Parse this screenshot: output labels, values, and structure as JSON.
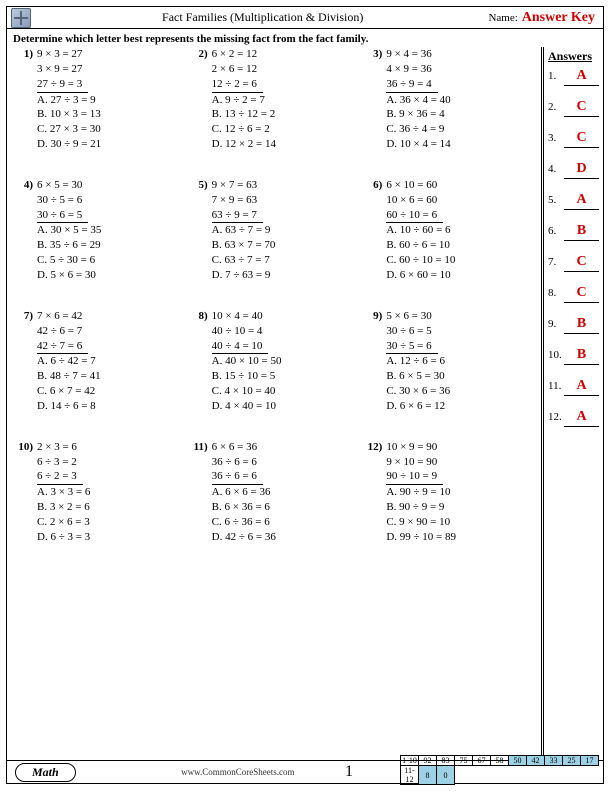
{
  "header": {
    "title": "Fact Families (Multiplication & Division)",
    "name_label": "Name:",
    "answer_key": "Answer Key"
  },
  "instructions": "Determine which letter best represents the missing fact from the fact family.",
  "answers_title": "Answers",
  "answers": [
    {
      "n": "1.",
      "v": "A"
    },
    {
      "n": "2.",
      "v": "C"
    },
    {
      "n": "3.",
      "v": "C"
    },
    {
      "n": "4.",
      "v": "D"
    },
    {
      "n": "5.",
      "v": "A"
    },
    {
      "n": "6.",
      "v": "B"
    },
    {
      "n": "7.",
      "v": "C"
    },
    {
      "n": "8.",
      "v": "C"
    },
    {
      "n": "9.",
      "v": "B"
    },
    {
      "n": "10.",
      "v": "B"
    },
    {
      "n": "11.",
      "v": "A"
    },
    {
      "n": "12.",
      "v": "A"
    }
  ],
  "problems": [
    {
      "n": "1)",
      "facts": [
        "9 × 3 = 27",
        "3 × 9 = 27",
        "27 ÷ 9 = 3"
      ],
      "choices": [
        "A. 27 ÷ 3 = 9",
        "B. 10 × 3 = 13",
        "C. 27 × 3 = 30",
        "D. 30 ÷ 9 = 21"
      ]
    },
    {
      "n": "2)",
      "facts": [
        "6 × 2 = 12",
        "2 × 6 = 12",
        "12 ÷ 2 = 6"
      ],
      "choices": [
        "A. 9 ÷ 2 = 7",
        "B. 13 ÷ 12 = 2",
        "C. 12 ÷ 6 = 2",
        "D. 12 × 2 = 14"
      ]
    },
    {
      "n": "3)",
      "facts": [
        "9 × 4 = 36",
        "4 × 9 = 36",
        "36 ÷ 9 = 4"
      ],
      "choices": [
        "A. 36 × 4 = 40",
        "B. 9 × 36 = 4",
        "C. 36 ÷ 4 = 9",
        "D. 10 × 4 = 14"
      ]
    },
    {
      "n": "4)",
      "facts": [
        "6 × 5 = 30",
        "30 ÷ 5 = 6",
        "30 ÷ 6 = 5"
      ],
      "choices": [
        "A. 30 × 5 = 35",
        "B. 35 ÷ 6 = 29",
        "C. 5 ÷ 30 = 6",
        "D. 5 × 6 = 30"
      ]
    },
    {
      "n": "5)",
      "facts": [
        "9 × 7 = 63",
        "7 × 9 = 63",
        "63 ÷ 9 = 7"
      ],
      "choices": [
        "A. 63 ÷ 7 = 9",
        "B. 63 × 7 = 70",
        "C. 63 ÷ 7 = 7",
        "D. 7 ÷ 63 = 9"
      ]
    },
    {
      "n": "6)",
      "facts": [
        "6 × 10 = 60",
        "10 × 6 = 60",
        "60 ÷ 10 = 6"
      ],
      "choices": [
        "A. 10 ÷ 60 = 6",
        "B. 60 ÷ 6 = 10",
        "C. 60 ÷ 10 = 10",
        "D. 6 × 60 = 10"
      ]
    },
    {
      "n": "7)",
      "facts": [
        "7 × 6 = 42",
        "42 ÷ 6 = 7",
        "42 ÷ 7 = 6"
      ],
      "choices": [
        "A. 6 ÷ 42 = 7",
        "B. 48 ÷ 7 = 41",
        "C. 6 × 7 = 42",
        "D. 14 ÷ 6 = 8"
      ]
    },
    {
      "n": "8)",
      "facts": [
        "10 × 4 = 40",
        "40 ÷ 10 = 4",
        "40 ÷ 4 = 10"
      ],
      "choices": [
        "A. 40 × 10 = 50",
        "B. 15 ÷ 10 = 5",
        "C. 4 × 10 = 40",
        "D. 4 × 40 = 10"
      ]
    },
    {
      "n": "9)",
      "facts": [
        "5 × 6 = 30",
        "30 ÷ 6 = 5",
        "30 ÷ 5 = 6"
      ],
      "choices": [
        "A. 12 ÷ 6 = 6",
        "B. 6 × 5 = 30",
        "C. 30 × 6 = 36",
        "D. 6 × 6 = 12"
      ]
    },
    {
      "n": "10)",
      "facts": [
        "2 × 3 = 6",
        "6 ÷ 3 = 2",
        "6 ÷ 2 = 3"
      ],
      "choices": [
        "A. 3 × 3 = 6",
        "B. 3 × 2 = 6",
        "C. 2 × 6 = 3",
        "D. 6 ÷ 3 = 3"
      ]
    },
    {
      "n": "11)",
      "facts": [
        "6 × 6 = 36",
        "36 ÷ 6 = 6",
        "36 ÷ 6 = 6"
      ],
      "choices": [
        "A. 6 × 6 = 36",
        "B. 6 × 36 = 6",
        "C. 6 ÷ 36 = 6",
        "D. 42 ÷ 6 = 36"
      ]
    },
    {
      "n": "12)",
      "facts": [
        "10 × 9 = 90",
        "9 × 10 = 90",
        "90 ÷ 10 = 9"
      ],
      "choices": [
        "A. 90 ÷ 9 = 10",
        "B. 90 ÷ 9 = 9",
        "C. 9 × 90 = 10",
        "D. 99 ÷ 10 = 89"
      ]
    }
  ],
  "footer": {
    "math_label": "Math",
    "website": "www.CommonCoreSheets.com",
    "page_number": "1",
    "score": {
      "row1_label": "1-10",
      "row1": [
        "92",
        "83",
        "75",
        "67",
        "58",
        "50",
        "42",
        "33",
        "25",
        "17"
      ],
      "row2_label": "11-12",
      "row2": [
        "8",
        "0"
      ]
    }
  }
}
